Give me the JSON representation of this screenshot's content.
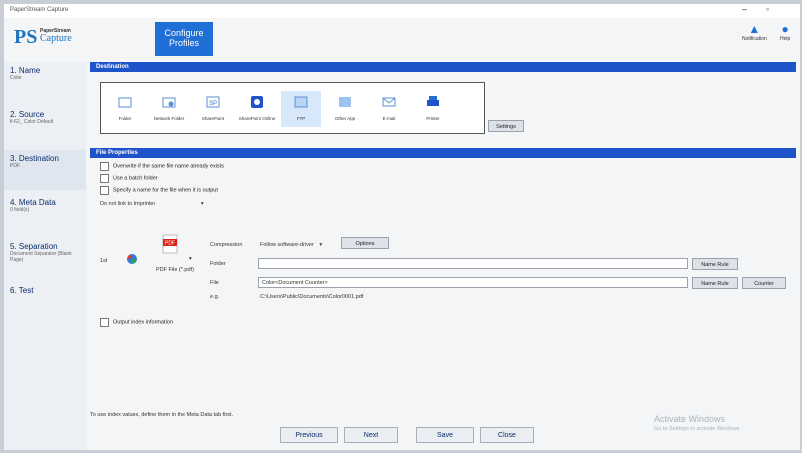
{
  "window": {
    "title": "PaperStream Capture"
  },
  "header": {
    "logo_small": "PaperStream",
    "logo_big": "Capture",
    "configure_profiles": "Configure Profiles",
    "notification": "Notification",
    "help": "Help"
  },
  "sidebar": {
    "items": [
      {
        "label": "1. Name",
        "sub": "Color"
      },
      {
        "label": "2. Source",
        "sub": "fi-62_ Color Default"
      },
      {
        "label": "3. Destination",
        "sub": "PDF"
      },
      {
        "label": "4. Meta Data",
        "sub": "0 field(s)"
      },
      {
        "label": "5. Separation",
        "sub": "Document Separator (Blank Page)"
      },
      {
        "label": "6. Test",
        "sub": ""
      }
    ]
  },
  "destination": {
    "section_title": "Destination",
    "items": [
      {
        "label": "Folder",
        "icon": "folder-icon"
      },
      {
        "label": "Network Folder",
        "icon": "network-folder-icon"
      },
      {
        "label": "SharePoint",
        "icon": "sharepoint-icon"
      },
      {
        "label": "SharePoint Online",
        "icon": "sharepoint-online-icon"
      },
      {
        "label": "FTP",
        "icon": "ftp-icon"
      },
      {
        "label": "Other App",
        "icon": "other-app-icon"
      },
      {
        "label": "E-mail",
        "icon": "email-icon"
      },
      {
        "label": "Printer",
        "icon": "printer-icon"
      }
    ],
    "settings_button": "Settings"
  },
  "file_properties": {
    "section_title": "File Properties",
    "overwrite": "Overwrite if the same file name already exists",
    "subfolder": "Use a batch folder",
    "specify_name": "Specify a name for the file when it is output",
    "link_select": "Do not link to Imprinter",
    "row_label": "1st",
    "file_type": "PDF File (*.pdf)",
    "compression_label": "Compression",
    "compression_value": "Follow software-driver",
    "option_button": "Options",
    "folder_label": "Folder",
    "folder_value": "",
    "file_label": "File",
    "file_value": "Color<Document Counter>",
    "example_label": "e.g.",
    "example_value": "C:\\Users\\Public\\Documents\\Color0001.pdf",
    "name_rule_1": "Name Rule",
    "name_rule_2": "Name Rule",
    "counter_button": "Counter",
    "output_index": "Output index information",
    "index_note": "To use index values, define them in the Meta Data tab first."
  },
  "nav": {
    "previous": "Previous",
    "next": "Next",
    "save": "Save",
    "close": "Close"
  },
  "watermark": {
    "activate": "Activate Windows",
    "activate_sub": "Go to Settings to activate Windows."
  },
  "colors": {
    "accent": "#1f53c9",
    "button_blue": "#1f6fd6",
    "pdf_red": "#d9261c"
  }
}
